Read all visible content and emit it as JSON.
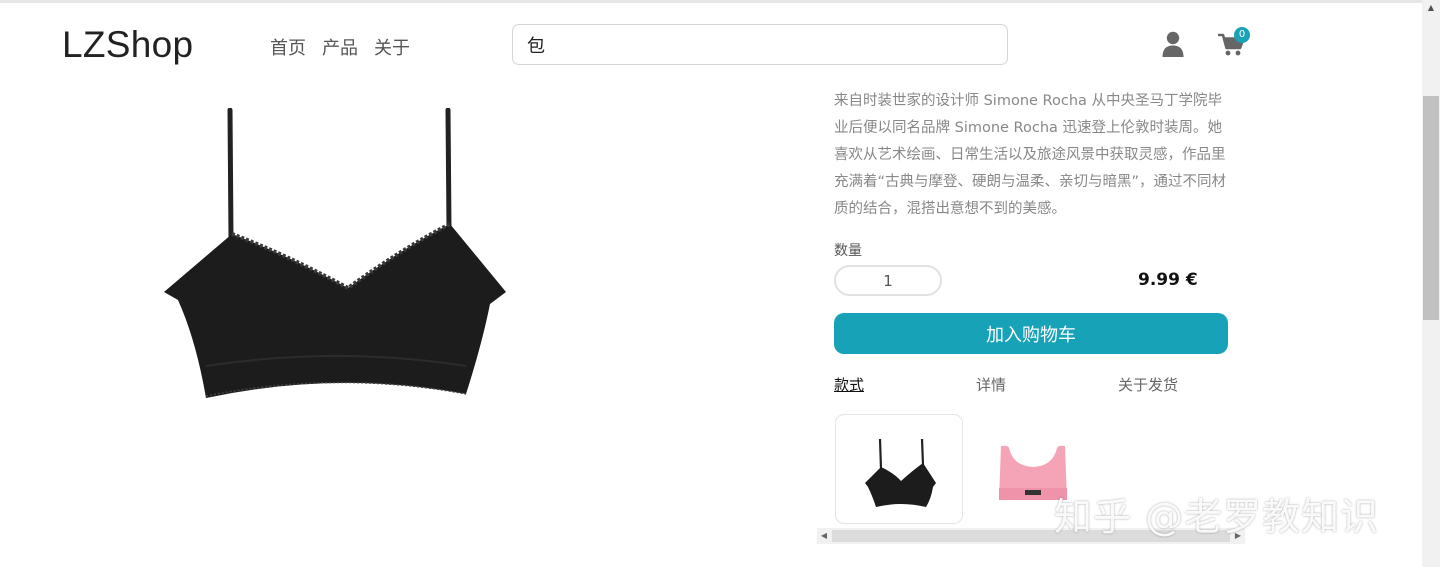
{
  "header": {
    "logo": "LZShop",
    "nav": [
      {
        "label": "首页"
      },
      {
        "label": "产品"
      },
      {
        "label": "关于"
      }
    ],
    "search": {
      "value": "包"
    },
    "cart_count": "0"
  },
  "product": {
    "description": "来自时装世家的设计师 Simone Rocha 从中央圣马丁学院毕业后便以同名品牌 Simone Rocha 迅速登上伦敦时装周。她喜欢从艺术绘画、日常生活以及旅途风景中获取灵感，作品里充满着“古典与摩登、硬朗与温柔、亲切与暗黑”，通过不同材质的结合，混搭出意想不到的美感。",
    "quantity_label": "数量",
    "quantity_value": "1",
    "price": "9.99 €",
    "add_to_cart_label": "加入购物车",
    "tabs": [
      {
        "label": "款式",
        "active": true
      },
      {
        "label": "详情",
        "active": false
      },
      {
        "label": "关于发货",
        "active": false
      }
    ],
    "variants": [
      {
        "name": "black-lace-bralette",
        "color": "#1e1e1e",
        "selected": true
      },
      {
        "name": "pink-sports-bra",
        "color": "#f4a4b6",
        "selected": false
      }
    ]
  },
  "watermark": "知乎 @老罗教知识",
  "colors": {
    "accent": "#17a2b8",
    "text_muted": "#888888"
  },
  "icons": [
    "user-icon",
    "cart-icon"
  ]
}
